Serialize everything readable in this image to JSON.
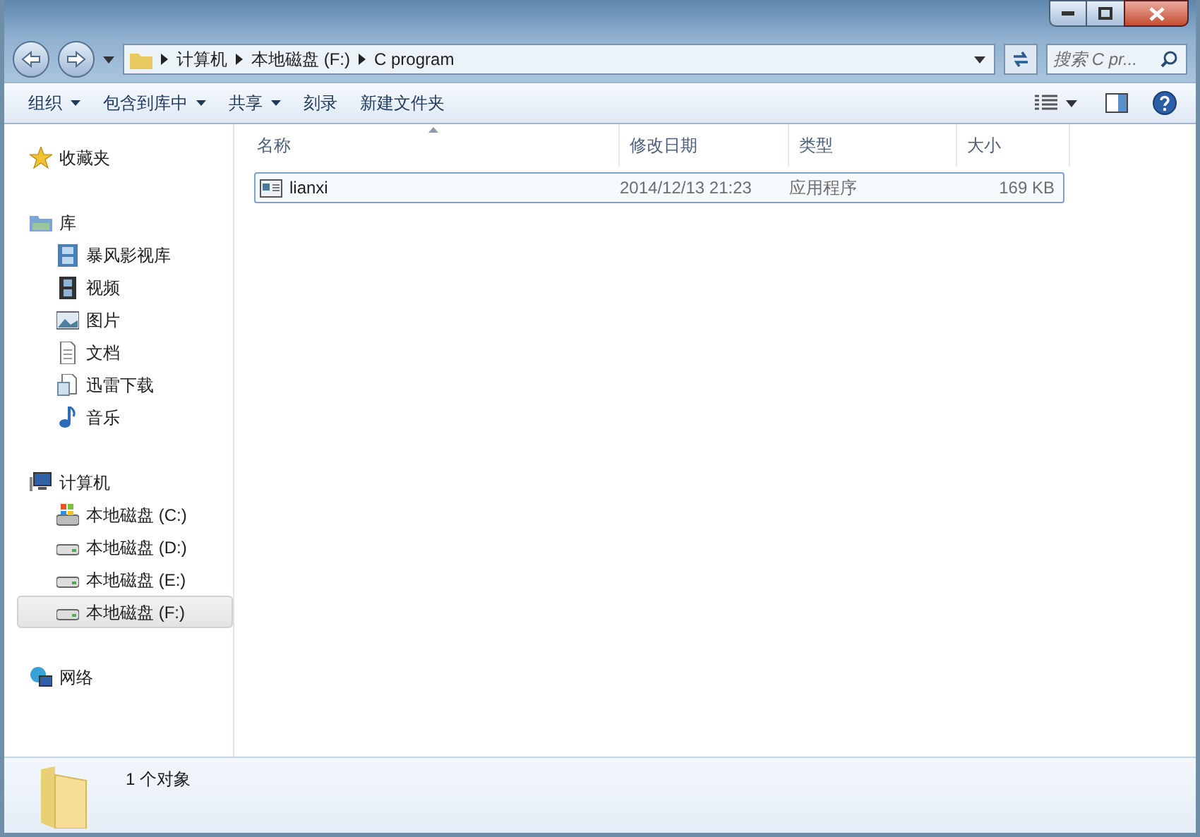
{
  "address": {
    "path": [
      "计算机",
      "本地磁盘 (F:)",
      "C program"
    ]
  },
  "search": {
    "placeholder": "搜索 C pr..."
  },
  "toolbar": [
    {
      "label": "组织",
      "dropdown": true
    },
    {
      "label": "包含到库中",
      "dropdown": true
    },
    {
      "label": "共享",
      "dropdown": true
    },
    {
      "label": "刻录",
      "dropdown": false
    },
    {
      "label": "新建文件夹",
      "dropdown": false
    }
  ],
  "nav": [
    {
      "label": "收藏夹",
      "kind": "star",
      "selected": false
    },
    {
      "label": "库",
      "kind": "library",
      "selected": false,
      "children": [
        {
          "label": "暴风影视库",
          "kind": "video-lib",
          "selected": false
        },
        {
          "label": "视频",
          "kind": "film",
          "selected": false
        },
        {
          "label": "图片",
          "kind": "image",
          "selected": false
        },
        {
          "label": "文档",
          "kind": "doc",
          "selected": false
        },
        {
          "label": "迅雷下载",
          "kind": "doc2",
          "selected": false
        },
        {
          "label": "音乐",
          "kind": "music",
          "selected": false
        }
      ]
    },
    {
      "label": "计算机",
      "kind": "computer",
      "selected": false,
      "children": [
        {
          "label": "本地磁盘 (C:)",
          "kind": "sysdrive",
          "selected": false
        },
        {
          "label": "本地磁盘 (D:)",
          "kind": "drive",
          "selected": false
        },
        {
          "label": "本地磁盘 (E:)",
          "kind": "drive",
          "selected": false
        },
        {
          "label": "本地磁盘 (F:)",
          "kind": "drive",
          "selected": true
        }
      ]
    },
    {
      "label": "网络",
      "kind": "network",
      "selected": false
    }
  ],
  "table": {
    "columns": [
      {
        "label": "名称",
        "sorted": true
      },
      {
        "label": "修改日期",
        "sorted": false
      },
      {
        "label": "类型",
        "sorted": false
      },
      {
        "label": "大小",
        "sorted": false
      }
    ],
    "rows": [
      {
        "name": "lianxi",
        "date": "2014/12/13 21:23",
        "type": "应用程序",
        "size": "169 KB",
        "selected": true
      }
    ]
  },
  "status_bar": {
    "text": "1 个对象"
  }
}
